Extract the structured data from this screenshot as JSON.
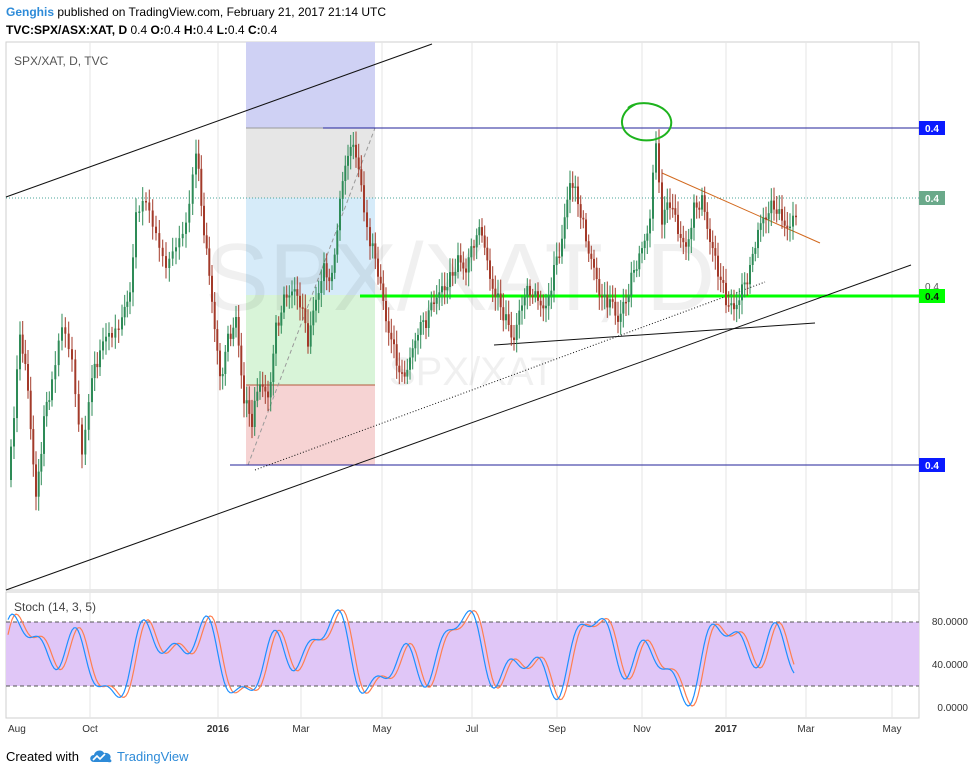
{
  "header": {
    "author": "Genghis",
    "published_text": "published on TradingView.com, February 21, 2017 21:14 UTC",
    "symbol_line": "TVC:SPX/ASX:XAT, D",
    "ohlc": [
      {
        "label": "O:",
        "value": "0.4"
      },
      {
        "label": "H:",
        "value": "0.4"
      },
      {
        "label": "L:",
        "value": "0.4"
      },
      {
        "label": "C:",
        "value": "0.4"
      }
    ],
    "first_value": "0.4"
  },
  "footer": {
    "created_with": "Created with",
    "brand": "TradingView"
  },
  "colors": {
    "up_candle": "#2e8b57",
    "down_candle": "#a33a2a",
    "support_line": "#00ff00",
    "level_label": "#0a1aff",
    "stoch_band": "#e0c6f7",
    "stoch_k": "#1e90ff",
    "stoch_d": "#ff7f50",
    "fib_blue": "#cfd1f4",
    "fib_grey": "#e6e6e6",
    "fib_cyan": "#d6ebf9",
    "fib_green": "#d8f4d8",
    "fib_red": "#f6d3d3"
  },
  "chart_data": {
    "type": "candlestick",
    "instrument_label": "SPX/XAT, D, TVC",
    "watermark_large": "SPX/XAT, D",
    "watermark_small": "SPX/XAT",
    "price_labels": [
      {
        "text": "0.4",
        "style": "blue"
      },
      {
        "text": "0.4",
        "style": "green"
      },
      {
        "text": "0.4",
        "style": "plain"
      },
      {
        "text": "0.4",
        "style": "lime"
      },
      {
        "text": "0.4",
        "style": "blue"
      }
    ],
    "x_ticks": [
      "Aug",
      "Oct",
      "2016",
      "Mar",
      "May",
      "Jul",
      "Sep",
      "Nov",
      "2017",
      "Mar",
      "May"
    ],
    "indicator": {
      "label": "Stoch (14, 3, 5)",
      "y_ticks": [
        "80.0000",
        "40.0000",
        "0.0000"
      ],
      "band": [
        20,
        80
      ],
      "ylim": [
        -8,
        110
      ]
    }
  }
}
